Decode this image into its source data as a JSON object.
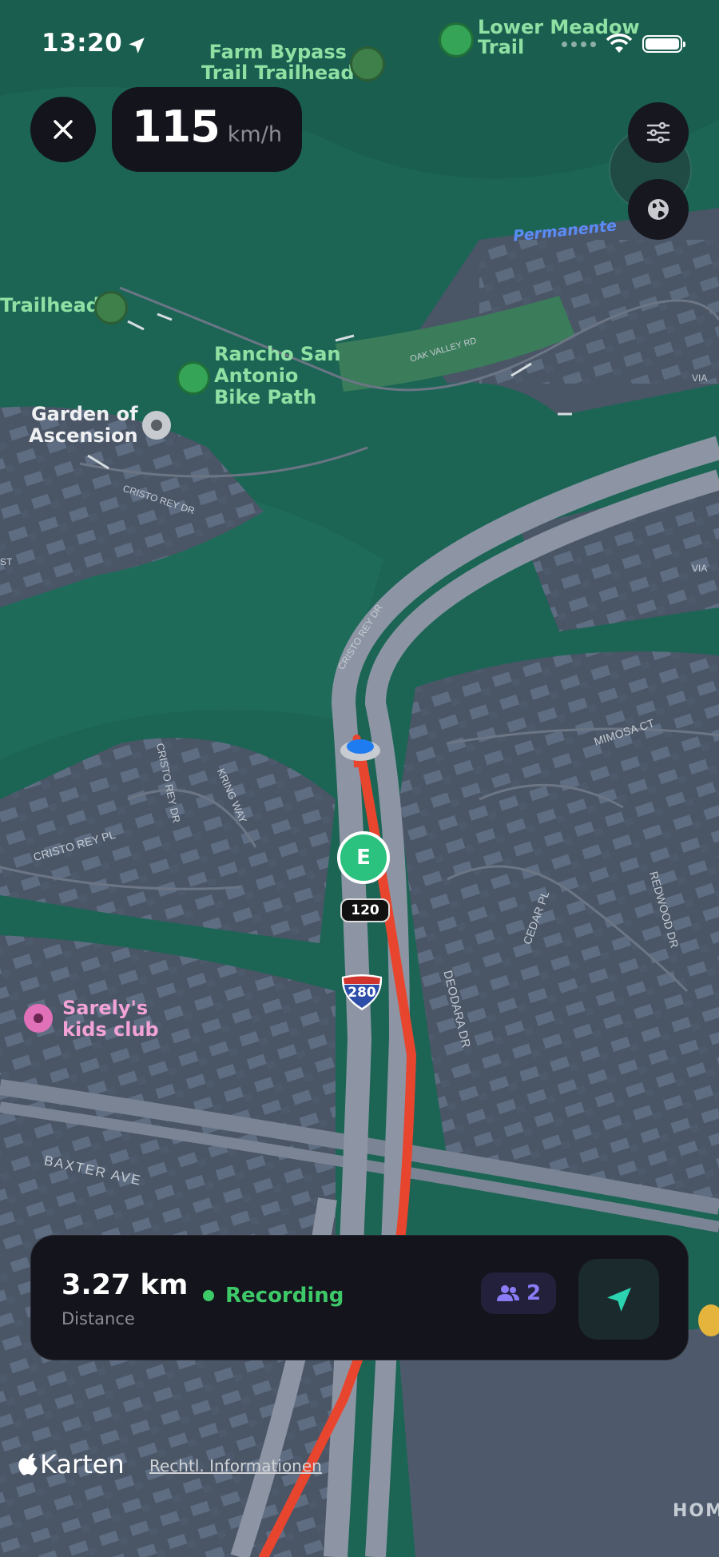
{
  "status_bar": {
    "time": "13:20"
  },
  "speed": {
    "value": "115",
    "unit": "km/h"
  },
  "map": {
    "pois": {
      "farm_bypass": [
        "Farm Bypass",
        "Trail Trailhead"
      ],
      "lower_meadow": [
        "Lower Meadow",
        "Trail"
      ],
      "trailhead": "Trailhead",
      "rancho": [
        "Rancho San",
        "Antonio",
        "Bike Path"
      ],
      "garden": [
        "Garden of",
        "Ascension"
      ],
      "sarely": [
        "Sarely's",
        "kids club"
      ]
    },
    "streets": {
      "permanente": "Permanente",
      "oak_valley": "OAK VALLEY RD",
      "via": "VIA",
      "cristo_rey_1": "CRISTO REY DR",
      "cristo_rey_2": "CRISTO REY DR",
      "cristo_rey_3": "CRISTO REY DR",
      "cristo_rey_pl": "CRISTO REY PL",
      "kring_way": "KRING WAY",
      "mimosa": "MIMOSA CT",
      "cedar": "CEDAR PL",
      "redwood": "REDWOOD DR",
      "deodara": "DEODARA DR",
      "baxter": "BAXTER AVE",
      "hom": "HOM",
      "st": "ST"
    },
    "marker_letter": "E",
    "speed_limit": "120",
    "highway_shield": "280"
  },
  "tracking": {
    "distance_value": "3.27 km",
    "distance_label": "Distance",
    "status": "Recording",
    "participants": "2"
  },
  "footer": {
    "brand": "Karten",
    "legal": "Rechtl. Informationen"
  },
  "colors": {
    "map_green": "#1c6555",
    "route": "#e8452f",
    "recording": "#3ec968",
    "accent_purple": "#8a7cf6",
    "nav_teal": "#2bd3b0"
  }
}
